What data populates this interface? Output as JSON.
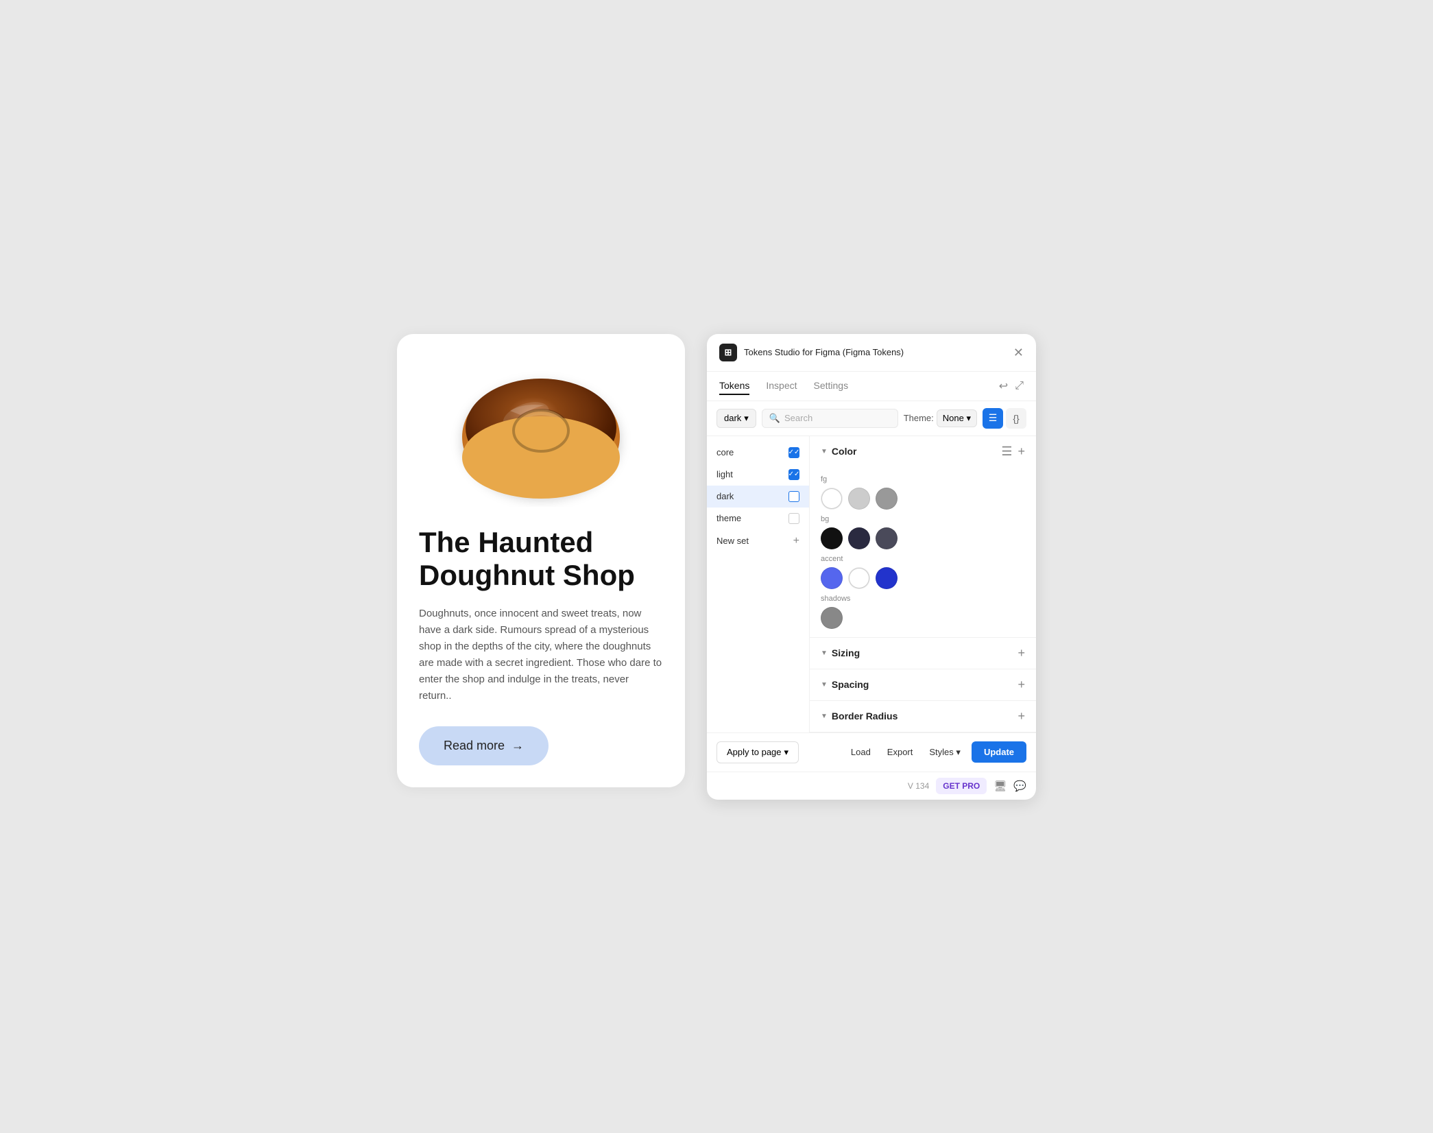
{
  "card": {
    "title": "The Haunted Doughnut Shop",
    "body": "Doughnuts, once innocent and sweet treats, now have a dark side. Rumours spread of a mysterious shop in the depths of the city, where the doughnuts are made with a secret ingredient. Those who dare to enter the shop and indulge in the treats, never return..",
    "read_more_label": "Read more",
    "arrow": "→"
  },
  "panel": {
    "app_icon": "⊞",
    "title": "Tokens Studio for Figma (Figma Tokens)",
    "close_label": "✕",
    "tabs": [
      {
        "label": "Tokens",
        "active": true
      },
      {
        "label": "Inspect",
        "active": false
      },
      {
        "label": "Settings",
        "active": false
      }
    ],
    "undo_icon": "↩",
    "expand_icon": "⤢",
    "toolbar": {
      "dark_dropdown_label": "dark",
      "dark_dropdown_caret": "▾",
      "search_icon": "🔍",
      "search_placeholder": "Search",
      "theme_label": "Theme:",
      "theme_none": "None",
      "theme_caret": "▾"
    },
    "view_buttons": [
      {
        "icon": "☰",
        "active": true
      },
      {
        "icon": "{}",
        "active": false
      }
    ],
    "sidebar": {
      "items": [
        {
          "label": "core",
          "checkbox": "blue",
          "selected": false
        },
        {
          "label": "light",
          "checkbox": "checked-blue",
          "selected": false
        },
        {
          "label": "dark",
          "checkbox": "empty",
          "selected": true
        },
        {
          "label": "theme",
          "checkbox": "empty",
          "selected": false
        }
      ],
      "new_set_label": "New set",
      "new_set_icon": "+"
    },
    "sections": {
      "color": {
        "label": "Color",
        "expanded": true,
        "subsections": [
          {
            "label": "fg",
            "swatches": [
              "#ffffff",
              "#cccccc",
              "#999999"
            ]
          },
          {
            "label": "bg",
            "swatches": [
              "#111111",
              "#2a2a40",
              "#4a4a5a"
            ]
          },
          {
            "label": "accent",
            "swatches": [
              "#5566ee",
              "#ffffff",
              "#2233cc"
            ]
          },
          {
            "label": "shadows",
            "swatches": [
              "#888888"
            ]
          }
        ]
      },
      "sizing": {
        "label": "Sizing",
        "expanded": false
      },
      "spacing": {
        "label": "Spacing",
        "expanded": false
      },
      "border_radius": {
        "label": "Border Radius",
        "expanded": false
      }
    },
    "footer": {
      "apply_to_page_label": "Apply to page",
      "apply_caret": "▾",
      "load_label": "Load",
      "export_label": "Export",
      "styles_label": "Styles",
      "styles_caret": "▾",
      "update_label": "Update"
    },
    "bottom": {
      "version": "V 134",
      "get_pro_label": "GET PRO",
      "monitor_icon": "🖥",
      "chat_icon": "💬"
    }
  }
}
